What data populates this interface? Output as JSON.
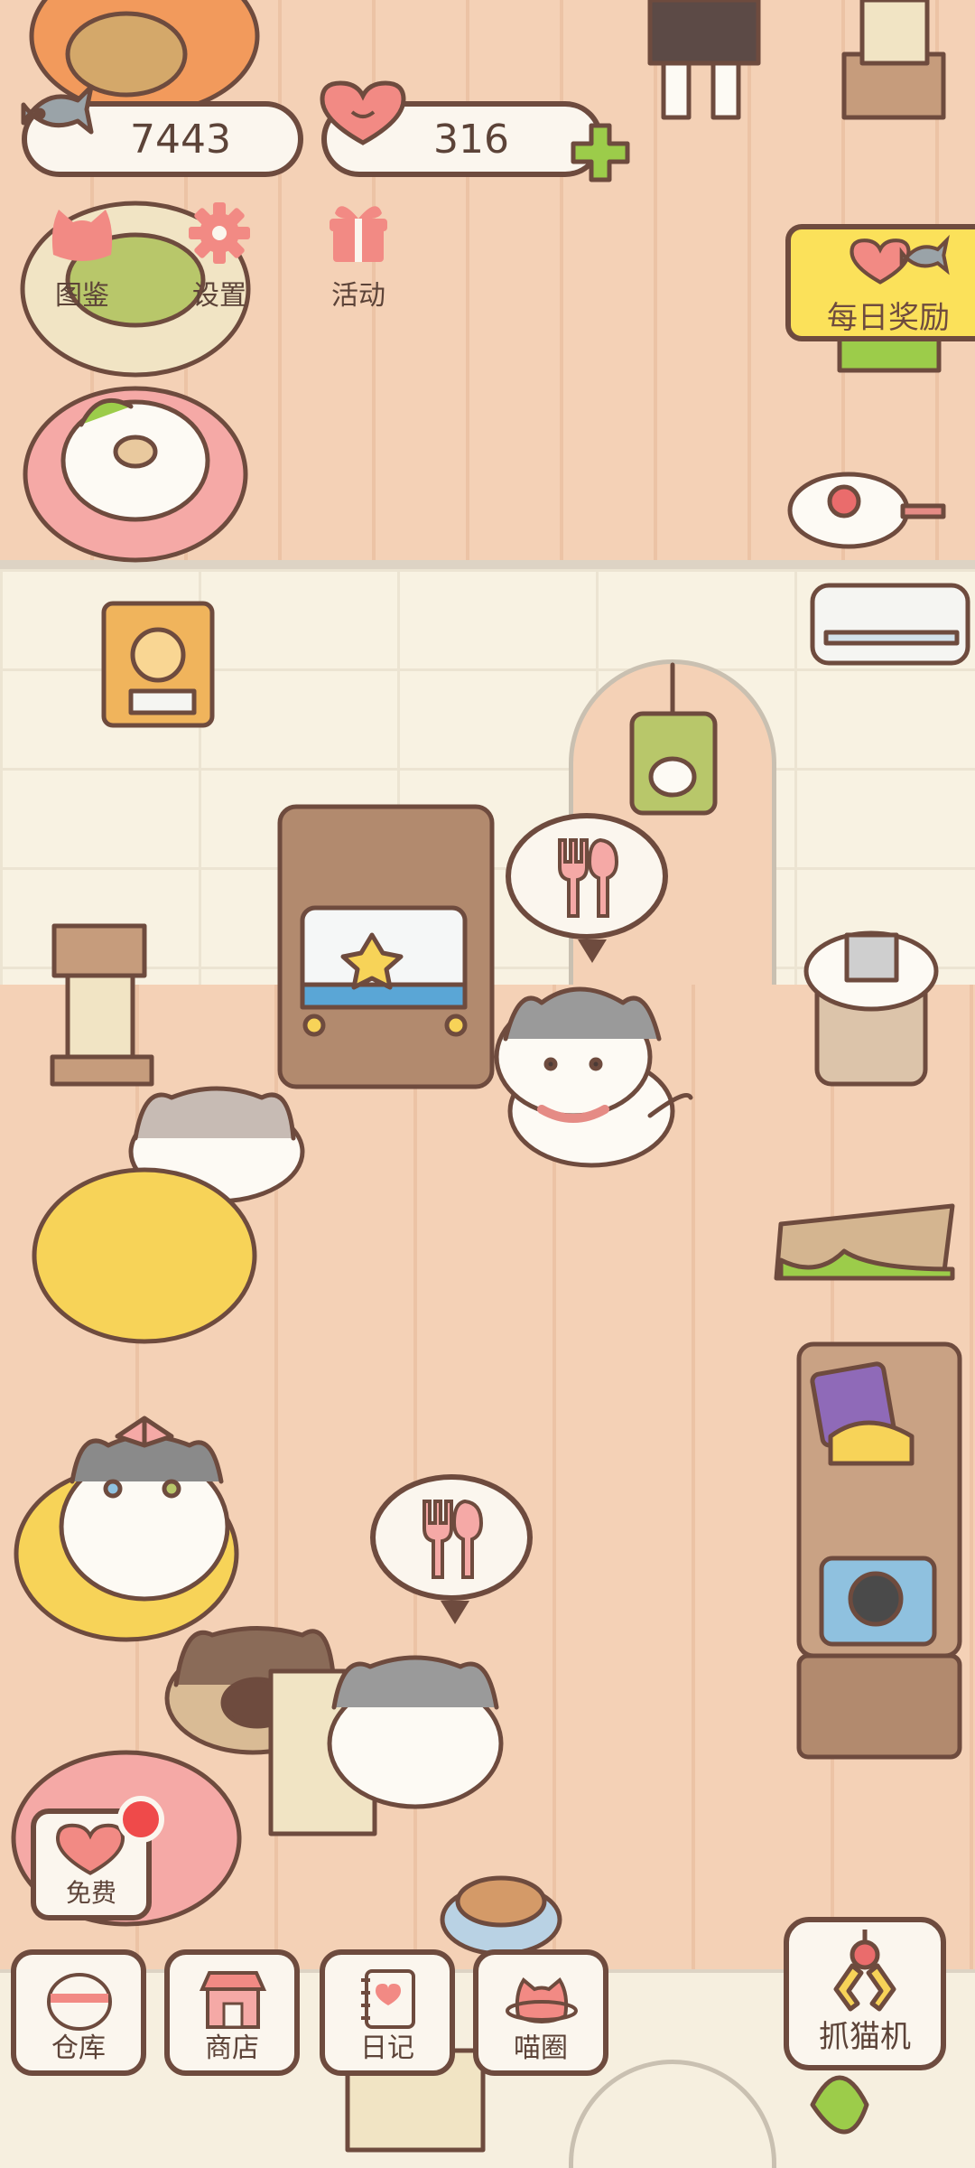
{
  "hud": {
    "fish_count": "7443",
    "heart_count": "316"
  },
  "menu": {
    "catalog": "图鉴",
    "settings": "设置",
    "events": "活动"
  },
  "daily_reward": {
    "label": "每日奖励"
  },
  "free_button": {
    "label": "免费"
  },
  "bottom_nav": {
    "warehouse": "仓库",
    "shop": "商店",
    "diary": "日记",
    "meow_circle": "喵圈"
  },
  "claw_machine": {
    "label": "抓猫机"
  },
  "colors": {
    "outline": "#6e4b3e",
    "accent_pink": "#f28a84",
    "accent_green": "#9ccc4a",
    "banner_yellow": "#fbe15a",
    "notification_red": "#ef4a4a"
  },
  "icons": {
    "fish": "fish-icon",
    "heart": "heart-icon",
    "plus": "plus-icon",
    "cat_head": "cat-head-icon",
    "gear": "gear-icon",
    "gift": "gift-icon",
    "food_bubble": "fork-spoon-icon"
  }
}
